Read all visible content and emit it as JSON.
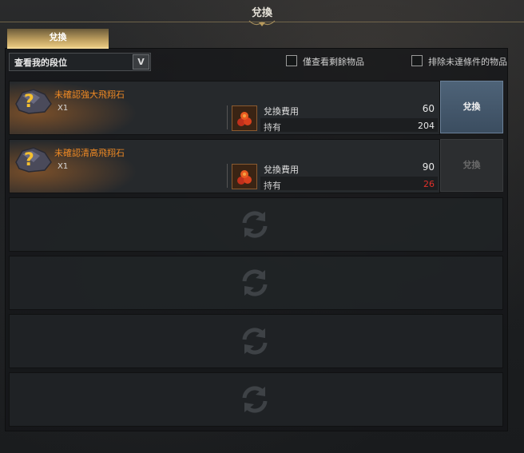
{
  "window": {
    "title": "兌換"
  },
  "tabs": [
    {
      "label": "兌換"
    }
  ],
  "filter": {
    "dropdown_value": "查看我的段位",
    "only_remaining_label": "僅查看剩餘物品",
    "exclude_unmet_label": "排除未達條件的物品"
  },
  "items": [
    {
      "name": "未確認強大飛翔石",
      "qty": "X1",
      "cost_label": "兌換費用",
      "cost": "60",
      "own_label": "持有",
      "own": "204",
      "own_color": "#e8e8e8",
      "button_label": "兌換",
      "enabled": true
    },
    {
      "name": "未確認清高飛翔石",
      "qty": "X1",
      "cost_label": "兌換費用",
      "cost": "90",
      "own_label": "持有",
      "own": "26",
      "own_color": "#e0302a",
      "button_label": "兌換",
      "enabled": false
    }
  ],
  "empty_slot_icon": "refresh-icon",
  "colors": {
    "item_name": "#f08a24",
    "insufficient": "#e0302a",
    "tab_gold": "#e8c880"
  }
}
